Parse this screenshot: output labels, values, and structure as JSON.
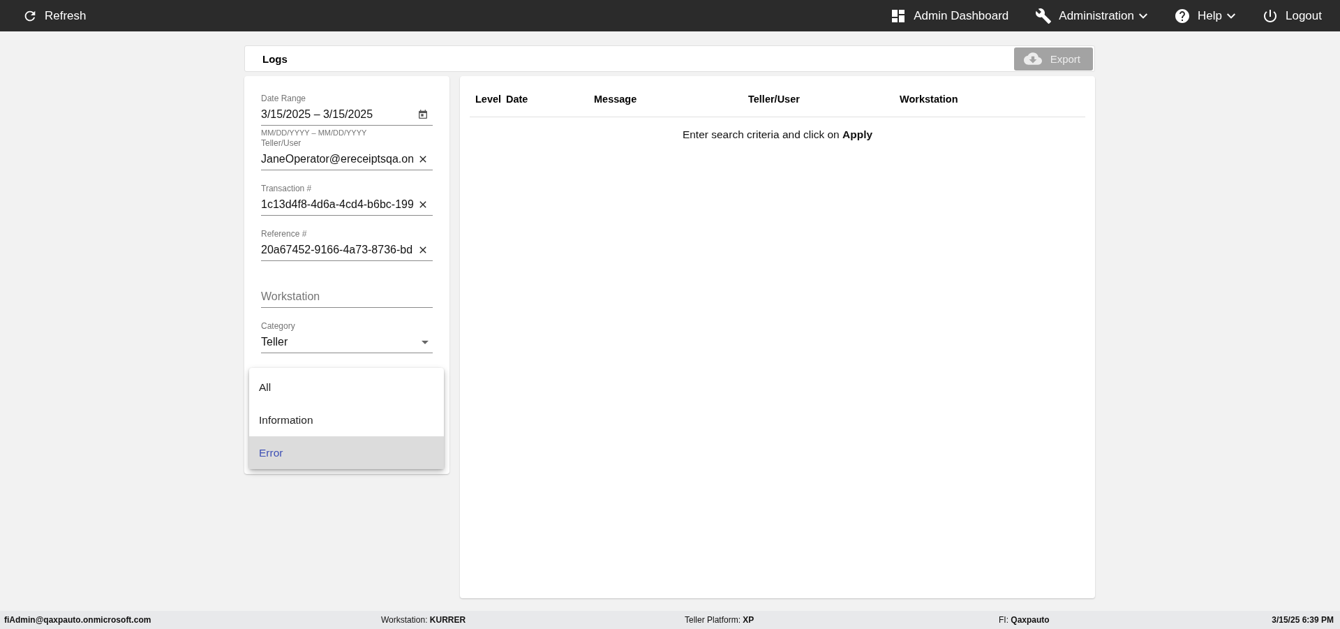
{
  "topbar": {
    "refresh": {
      "label": "Refresh"
    },
    "items": [
      {
        "label": "Admin Dashboard",
        "kind": "dashboard",
        "dropdown": false
      },
      {
        "label": "Administration",
        "kind": "tools",
        "dropdown": true
      },
      {
        "label": "Help",
        "kind": "help",
        "dropdown": true
      },
      {
        "label": "Logout",
        "kind": "power",
        "dropdown": false
      }
    ]
  },
  "header": {
    "title": "Logs",
    "export": {
      "label": "Export",
      "disabled": true
    }
  },
  "filters": [
    {
      "kind": "date",
      "label": "Date Range",
      "value": "3/15/2025 – 3/15/2025",
      "hint": "MM/DD/YYYY – MM/DD/YYYY"
    },
    {
      "kind": "text",
      "label": "Teller/User",
      "value": "JaneOperator@ereceiptsqa.on",
      "clearable": true
    },
    {
      "kind": "text",
      "label": "Transaction #",
      "value": "1c13d4f8-4d6a-4cd4-b6bc-199",
      "clearable": true
    },
    {
      "kind": "text",
      "label": "Reference #",
      "value": "20a67452-9166-4a73-8736-bd",
      "clearable": true
    },
    {
      "kind": "text",
      "placeholder": "Workstation",
      "clearable": false
    },
    {
      "kind": "select",
      "label": "Category",
      "value": "Teller"
    }
  ],
  "level_menu": {
    "options": [
      {
        "label": "All",
        "selected": false
      },
      {
        "label": "Information",
        "selected": false
      },
      {
        "label": "Error",
        "selected": true
      }
    ]
  },
  "table": {
    "columns": [
      "Level",
      "Date",
      "Message",
      "Teller/User",
      "Workstation"
    ],
    "empty_message": "Enter search criteria and click on **Apply**"
  },
  "status_bar": {
    "user": "fiAdmin@qaxpauto.onmicrosoft.com",
    "fields": [
      "Workstation: **KURRER**",
      "Teller Platform: **XP**",
      "FI: **Qaxpauto**"
    ],
    "datetime": "3/15/25 6:39 PM"
  }
}
